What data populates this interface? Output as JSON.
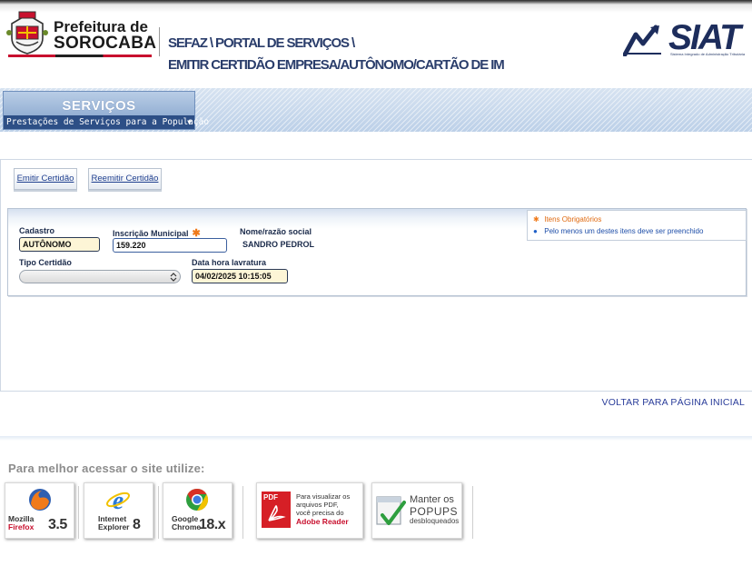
{
  "header": {
    "org_line1": "Prefeitura de",
    "org_line2": "SOROCABA",
    "breadcrumb_line1": "SEFAZ \\ PORTAL DE SERVIÇOS \\",
    "breadcrumb_line2": "EMITIR CERTIDÃO EMPRESA/AUTÔNOMO/CARTÃO DE IM",
    "siat_logo": "SIAT",
    "siat_subtitle": "Sistema Integrado de Administração Tributária"
  },
  "services_menu": {
    "title": "SERVIÇOS",
    "subtitle": "Prestações de Serviços para a População",
    "caret": "▼"
  },
  "tabs": [
    {
      "label": "Emitir Certidão"
    },
    {
      "label": "Reemitir Certidão"
    }
  ],
  "legend": {
    "required_icon": "✱",
    "required_label": "Itens Obrigatórios",
    "one_of_icon": "●",
    "one_of_label": "Pelo menos um destes itens deve ser preenchido"
  },
  "form": {
    "cadastro": {
      "label": "Cadastro",
      "value": "AUTÔNOMO"
    },
    "inscricao": {
      "label": "Inscrição Municipal",
      "required_mark": "✱",
      "value": "159.220"
    },
    "nome": {
      "label": "Nome/razão social",
      "value": "SANDRO PEDROL"
    },
    "tipo_certidao": {
      "label": "Tipo Certidão",
      "value": ""
    },
    "data_hora": {
      "label": "Data hora lavratura",
      "value": "04/02/2025 10:15:05"
    }
  },
  "voltar_link": "VOLTAR PARA PÁGINA INICIAL",
  "footer": {
    "best_access_text": "Para melhor acessar o site utilize:",
    "browsers": [
      {
        "name_line1": "Mozilla",
        "name_line2": "Firefox",
        "version": "3.5",
        "icon": "firefox-icon"
      },
      {
        "name_line1": "Internet",
        "name_line2": "Explorer",
        "version": "8",
        "icon": "ie-icon"
      },
      {
        "name_line1": "Google",
        "name_line2": "Chrome",
        "version": "18.x",
        "icon": "chrome-icon"
      }
    ],
    "adobe": {
      "lines": [
        "Para visualizar os",
        "arquivos PDF,",
        "você precisa do"
      ],
      "product": "Adobe Reader",
      "pdf_label": "PDF"
    },
    "popups": {
      "line1": "Manter os",
      "line2": "POPUPS",
      "line3": "desbloqueados"
    }
  },
  "colors": {
    "accent_blue": "#2a3d6b",
    "required_orange": "#f07a1a",
    "one_of_blue": "#1e5fc8",
    "field_fill": "#fdf5d6"
  }
}
